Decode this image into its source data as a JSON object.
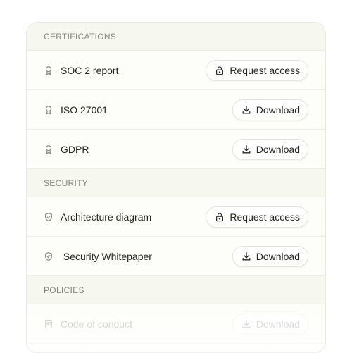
{
  "sections": [
    {
      "title": "CERTIFICATIONS",
      "items": [
        {
          "label": "SOC 2 report",
          "icon": "award-icon",
          "action": "Request access",
          "action_icon": "lock-icon"
        },
        {
          "label": "ISO 27001",
          "icon": "award-icon",
          "action": "Download",
          "action_icon": "download-icon"
        },
        {
          "label": "GDPR",
          "icon": "award-icon",
          "action": "Download",
          "action_icon": "download-icon"
        }
      ]
    },
    {
      "title": "SECURITY",
      "items": [
        {
          "label": "Architecture diagram",
          "icon": "shield-icon",
          "action": "Request access",
          "action_icon": "lock-icon"
        },
        {
          "label": " Security Whitepaper",
          "icon": "shield-icon",
          "action": "Download",
          "action_icon": "download-icon"
        }
      ]
    },
    {
      "title": "POLICIES",
      "items": [
        {
          "label": "Code of conduct",
          "icon": "document-icon",
          "action": "Download",
          "action_icon": "download-icon"
        }
      ]
    }
  ],
  "colors": {
    "card_bg": "#fdfdf9",
    "header_bg": "#f6f7ef",
    "text": "#26281f",
    "muted": "#85887e"
  }
}
